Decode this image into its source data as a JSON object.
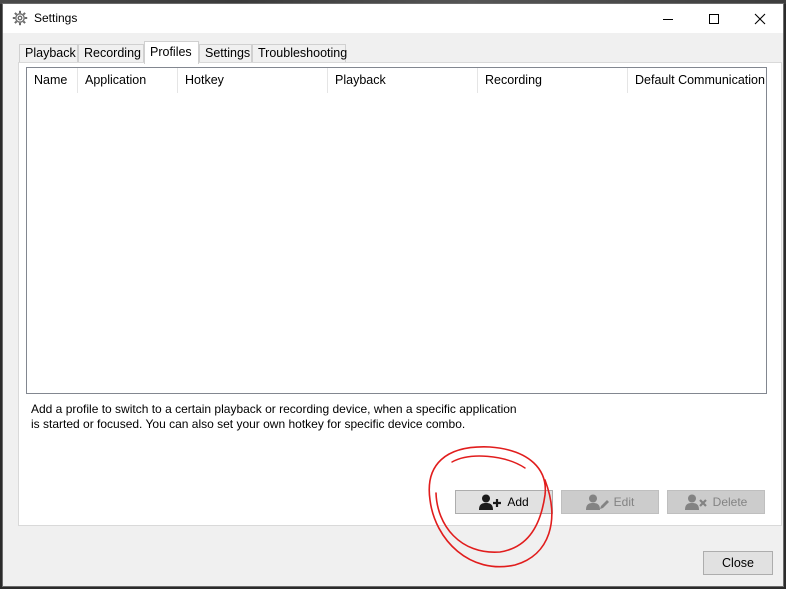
{
  "window": {
    "title": "Settings",
    "icon": "gear-icon",
    "controls": [
      "minimize-icon",
      "maximize-icon",
      "close-icon"
    ]
  },
  "tabs": [
    {
      "label": "Playback",
      "active": false
    },
    {
      "label": "Recording",
      "active": false
    },
    {
      "label": "Profiles",
      "active": true
    },
    {
      "label": "Settings",
      "active": false
    },
    {
      "label": "Troubleshooting",
      "active": false
    }
  ],
  "profiles_table": {
    "columns": [
      "Name",
      "Application",
      "Hotkey",
      "Playback",
      "Recording",
      "Default Communication."
    ],
    "rows": []
  },
  "description": {
    "line1": "Add a profile to switch to a certain playback or recording device, when a specific application",
    "line2": "is started or focused. You can also set your own hotkey for specific device combo."
  },
  "buttons": {
    "add": {
      "label": "Add",
      "icon": "add-user-icon",
      "enabled": true
    },
    "edit": {
      "label": "Edit",
      "icon": "edit-user-icon",
      "enabled": false
    },
    "delete": {
      "label": "Delete",
      "icon": "delete-user-icon",
      "enabled": false
    },
    "close": {
      "label": "Close"
    }
  },
  "colors": {
    "annotation": "#e11d1d",
    "disabled_button": "#cccccc",
    "active_tab": "#ffffff"
  }
}
